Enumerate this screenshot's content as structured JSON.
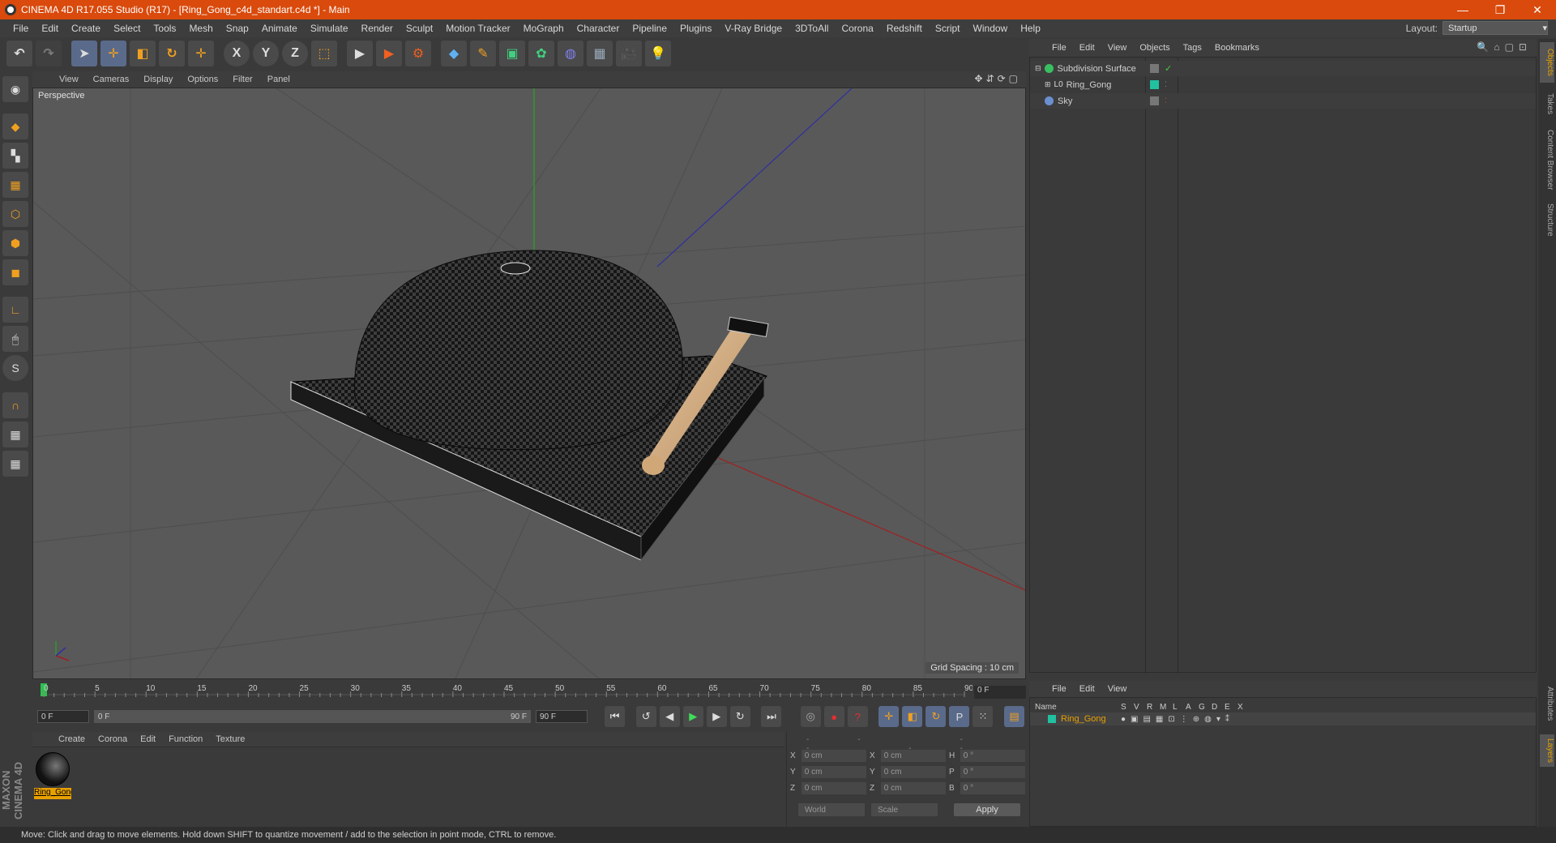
{
  "window": {
    "title": "CINEMA 4D R17.055 Studio (R17) - [Ring_Gong_c4d_standart.c4d *] - Main",
    "minimize": "—",
    "restore": "❐",
    "close": "✕"
  },
  "menu": [
    "File",
    "Edit",
    "Create",
    "Select",
    "Tools",
    "Mesh",
    "Snap",
    "Animate",
    "Simulate",
    "Render",
    "Sculpt",
    "Motion Tracker",
    "MoGraph",
    "Character",
    "Pipeline",
    "Plugins",
    "V-Ray Bridge",
    "3DToAll",
    "Corona",
    "Redshift",
    "Script",
    "Window",
    "Help"
  ],
  "layout": {
    "label": "Layout:",
    "value": "Startup"
  },
  "toolbar": {
    "undo": "↶",
    "redo": "↷",
    "select": "➤",
    "move": "✛",
    "scale": "◧",
    "rotate": "↻",
    "last": "✛",
    "x": "X",
    "y": "Y",
    "z": "Z",
    "coord": "⬚",
    "render_view": "▶",
    "render": "▶",
    "render_settings": "⚙",
    "cube": "◆",
    "pen": "✎",
    "subdiv": "▣",
    "array": "✿",
    "deform": "◍",
    "floor": "▦",
    "camera": "🎥",
    "light": "💡"
  },
  "viewport": {
    "menu": [
      "View",
      "Cameras",
      "Display",
      "Options",
      "Filter",
      "Panel"
    ],
    "icons": "✥⇵⟳▢",
    "label": "Perspective",
    "grid_spacing": "Grid Spacing : 10 cm"
  },
  "timeline": {
    "ticks": [
      "0",
      "5",
      "10",
      "15",
      "20",
      "25",
      "30",
      "35",
      "40",
      "45",
      "50",
      "55",
      "60",
      "65",
      "70",
      "75",
      "80",
      "85",
      "90"
    ],
    "frame": "0 F",
    "start": "0 F",
    "range_start": "0 F",
    "range_end": "90 F",
    "end": "90 F"
  },
  "playback": {
    "first": "⏮",
    "prev_key": "↺",
    "prev": "◀",
    "play": "▶",
    "next": "▶",
    "next_key": "↻",
    "last": "⏭",
    "key_rec": "◎",
    "auto_key": "●",
    "key_help": "?",
    "move_key": "✛",
    "scale_key": "◧",
    "rot_key": "↻",
    "param_key": "P",
    "pla": "⁙",
    "timeline_btn": "▤"
  },
  "material_manager": {
    "menu": [
      "Create",
      "Corona",
      "Edit",
      "Function",
      "Texture"
    ],
    "material_name": "Ring_Gong"
  },
  "coordinates": {
    "header": "-- -- --",
    "rows": [
      {
        "l1": "X",
        "v1": "0 cm",
        "l2": "X",
        "v2": "0 cm",
        "l3": "H",
        "v3": "0 °"
      },
      {
        "l1": "Y",
        "v1": "0 cm",
        "l2": "Y",
        "v2": "0 cm",
        "l3": "P",
        "v3": "0 °"
      },
      {
        "l1": "Z",
        "v1": "0 cm",
        "l2": "Z",
        "v2": "0 cm",
        "l3": "B",
        "v3": "0 °"
      }
    ],
    "world": "World",
    "scale": "Scale",
    "apply": "Apply"
  },
  "object_manager": {
    "menu": [
      "File",
      "Edit",
      "View",
      "Objects",
      "Tags",
      "Bookmarks"
    ],
    "icons": "🔍⌂▢⊡",
    "objects": [
      {
        "name": "Subdivision Surface",
        "icon_color": "#38c060"
      },
      {
        "name": "Ring_Gong",
        "icon_color": "#b0b0b0",
        "tag_color": "#20c0a0"
      },
      {
        "name": "Sky",
        "icon_color": "#6a90d0"
      }
    ]
  },
  "layers_manager": {
    "menu": [
      "File",
      "Edit",
      "View"
    ],
    "columns": [
      "Name",
      "S",
      "V",
      "R",
      "M",
      "L",
      "A",
      "G",
      "D",
      "E",
      "X"
    ],
    "layer": {
      "name": "Ring_Gong",
      "color": "#20c0a0"
    }
  },
  "right_tabs": [
    "Objects",
    "Takes",
    "Content Browser",
    "Structure",
    "Attributes",
    "Layers"
  ],
  "status": "Move: Click and drag to move elements. Hold down SHIFT to quantize movement / add to the selection in point mode, CTRL to remove.",
  "logo": "MAXON CINEMA 4D",
  "colors": {
    "title_bar": "#d94a0c",
    "accent": "#e8a000",
    "viewport_bg": "#595959",
    "wood": "#d8b48a"
  }
}
